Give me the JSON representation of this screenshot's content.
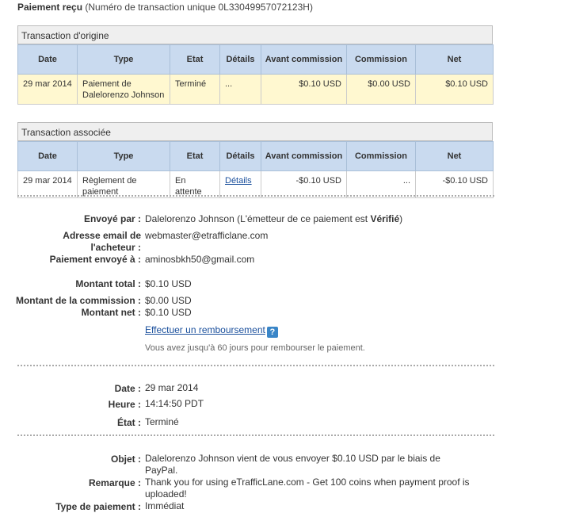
{
  "header": {
    "title": "Paiement reçu",
    "txn_prefix": "(Numéro de transaction unique ",
    "txn_id": "0L33049957072123H",
    "txn_suffix": ")"
  },
  "columns": [
    "Date",
    "Type",
    "Etat",
    "Détails",
    "Avant commission",
    "Commission",
    "Net"
  ],
  "original_transaction": {
    "title": "Transaction d'origine",
    "row": {
      "date": "29 mar 2014",
      "type": "Paiement de Dalelorenzo Johnson",
      "etat": "Terminé",
      "details": "...",
      "avant": "$0.10 USD",
      "commission": "$0.00 USD",
      "net": "$0.10 USD"
    }
  },
  "related_transaction": {
    "title": "Transaction associée",
    "row": {
      "date": "29 mar 2014",
      "type": "Règlement de paiement",
      "etat": "En attente",
      "details": "Détails",
      "avant": "-$0.10 USD",
      "commission": "...",
      "net": "-$0.10 USD"
    }
  },
  "details": {
    "sent_by_label": "Envoyé par :",
    "sent_by_value": "Dalelorenzo Johnson (L'émetteur de ce paiement est ",
    "sent_by_status": "Vérifié",
    "sent_by_close": ")",
    "buyer_email_label": "Adresse email de l'acheteur :",
    "buyer_email_value": "webmaster@etrafficlane.com",
    "sent_to_label": "Paiement envoyé à :",
    "sent_to_value": "aminosbkh50@gmail.com",
    "total_label": "Montant total :",
    "total_value": "$0.10 USD",
    "fee_label": "Montant de la commission :",
    "fee_value": "$0.00 USD",
    "net_label": "Montant net :",
    "net_value": "$0.10 USD",
    "refund_link": "Effectuer un remboursement",
    "refund_note": "Vous avez jusqu'à 60 jours pour rembourser le paiement."
  },
  "timing": {
    "date_label": "Date :",
    "date_value": "29 mar 2014",
    "time_label": "Heure :",
    "time_value": "14:14:50 PDT",
    "state_label": "État :",
    "state_value": "Terminé"
  },
  "message": {
    "subject_label": "Objet :",
    "subject_value": "Dalelorenzo Johnson vient de vous envoyer $0.10 USD par le biais de PayPal.",
    "note_label": "Remarque :",
    "note_value": "Thank you for using eTrafficLane.com - Get 100 coins when payment proof is uploaded!",
    "type_label": "Type de paiement :",
    "type_value": "Immédiat"
  },
  "icons": {
    "help": "question-icon"
  },
  "colors": {
    "table_header": "#c9daef",
    "highlight_row": "#fff8d0",
    "link": "#1a4f9c",
    "help_icon": "#3a86c8"
  }
}
